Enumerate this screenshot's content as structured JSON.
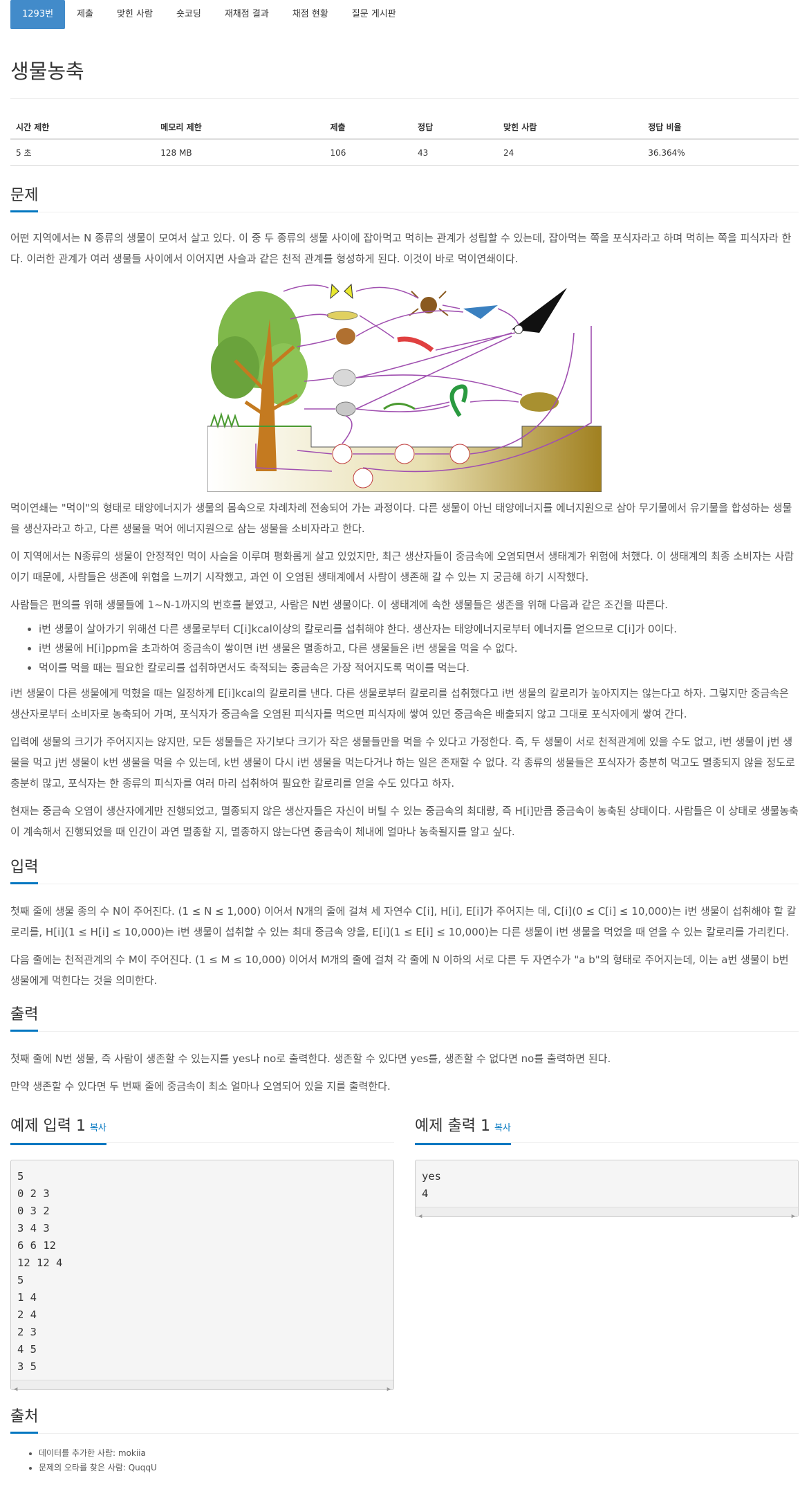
{
  "tabs": [
    {
      "label": "1293번",
      "active": true
    },
    {
      "label": "제출"
    },
    {
      "label": "맞힌 사람"
    },
    {
      "label": "숏코딩"
    },
    {
      "label": "재채점 결과"
    },
    {
      "label": "채점 현황"
    },
    {
      "label": "질문 게시판"
    }
  ],
  "problem_title": "생물농축",
  "info_table": {
    "headers": [
      "시간 제한",
      "메모리 제한",
      "제출",
      "정답",
      "맞힌 사람",
      "정답 비율"
    ],
    "values": [
      "5 초",
      "128 MB",
      "106",
      "43",
      "24",
      "36.364%"
    ]
  },
  "sections": {
    "problem": "문제",
    "input": "입력",
    "output": "출력",
    "source": "출처"
  },
  "problem_paragraphs": {
    "p1": "어떤 지역에서는 N 종류의 생물이 모여서 살고 있다. 이 중 두 종류의 생물 사이에 잡아먹고 먹히는 관계가 성립할 수 있는데, 잡아먹는 쪽을 포식자라고 하며 먹히는 쪽을 피식자라 한다. 이러한 관계가 여러 생물들 사이에서 이어지면 사슬과 같은 천적 관계를 형성하게 된다. 이것이 바로 먹이연쇄이다.",
    "p2": "먹이연쇄는 \"먹이\"의 형태로 태양에너지가 생물의 몸속으로 차례차례 전송되어 가는 과정이다. 다른 생물이 아닌 태양에너지를 에너지원으로 삼아 무기물에서 유기물을 합성하는 생물을 생산자라고 하고, 다른 생물을 먹어 에너지원으로 삼는 생물을 소비자라고 한다.",
    "p3": "이 지역에서는 N종류의 생물이 안정적인 먹이 사슬을 이루며 평화롭게 살고 있었지만, 최근 생산자들이 중금속에 오염되면서 생태계가 위험에 처했다. 이 생태계의 최종 소비자는 사람이기 때문에, 사람들은 생존에 위협을 느끼기 시작했고, 과연 이 오염된 생태계에서 사람이 생존해 갈 수 있는 지 궁금해 하기 시작했다.",
    "p4": "사람들은 편의를 위해 생물들에 1~N-1까지의 번호를 붙였고, 사람은 N번 생물이다. 이 생태계에 속한 생물들은 생존을 위해 다음과 같은 조건을 따른다.",
    "bullets": [
      "i번 생물이 살아가기 위해선 다른 생물로부터 C[i]kcal이상의 칼로리를 섭취해야 한다. 생산자는 태양에너지로부터 에너지를 얻으므로 C[i]가 0이다.",
      "i번 생물에 H[i]ppm을 초과하여 중금속이 쌓이면 i번 생물은 멸종하고, 다른 생물들은 i번 생물을 먹을 수 없다.",
      "먹이를 먹을 때는 필요한 칼로리를 섭취하면서도 축적되는 중금속은 가장 적어지도록 먹이를 먹는다."
    ],
    "p5": "i번 생물이 다른 생물에게 먹혔을 때는 일정하게 E[i]kcal의 칼로리를 낸다. 다른 생물로부터 칼로리를 섭취했다고 i번 생물의 칼로리가 높아지지는 않는다고 하자. 그렇지만 중금속은 생산자로부터 소비자로 농축되어 가며, 포식자가 중금속을 오염된 피식자를 먹으면 피식자에 쌓여 있던 중금속은 배출되지 않고 그대로 포식자에게 쌓여 간다.",
    "p6": "입력에 생물의 크기가 주어지지는 않지만, 모든 생물들은 자기보다 크기가 작은 생물들만을 먹을 수 있다고 가정한다. 즉, 두 생물이 서로 천적관계에 있을 수도 없고, i번 생물이 j번 생물을 먹고 j번 생물이 k번 생물을 먹을 수 있는데, k번 생물이 다시 i번 생물을 먹는다거나 하는 일은 존재할 수 없다. 각 종류의 생물들은 포식자가 충분히 먹고도 멸종되지 않을 정도로 충분히 많고, 포식자는 한 종류의 피식자를 여러 마리 섭취하여 필요한 칼로리를 얻을 수도 있다고 하자.",
    "p7": "현재는 중금속 오염이 생산자에게만 진행되었고, 멸종되지 않은 생산자들은 자신이 버틸 수 있는 중금속의 최대량, 즉 H[i]만큼 중금속이 농축된 상태이다. 사람들은 이 상태로 생물농축이 계속해서 진행되었을 때 인간이 과연 멸종할 지, 멸종하지 않는다면 중금속이 체내에 얼마나 농축될지를 알고 싶다."
  },
  "input_paragraphs": [
    "첫째 줄에 생물 종의 수 N이 주어진다. (1 ≤ N ≤ 1,000) 이어서 N개의 줄에 걸쳐 세 자연수 C[i], H[i], E[i]가 주어지는 데, C[i](0 ≤ C[i] ≤ 10,000)는 i번 생물이 섭취해야 할 칼로리를, H[i](1 ≤ H[i] ≤ 10,000)는 i번 생물이 섭취할 수 있는 최대 중금속 양을, E[i](1 ≤ E[i] ≤ 10,000)는 다른 생물이 i번 생물을 먹었을 때 얻을 수 있는 칼로리를 가리킨다.",
    "다음 줄에는 천적관계의 수 M이 주어진다. (1 ≤ M ≤ 10,000) 이어서 M개의 줄에 걸쳐 각 줄에 N 이하의 서로 다른 두 자연수가 \"a b\"의 형태로 주어지는데, 이는 a번 생물이 b번 생물에게 먹힌다는 것을 의미한다."
  ],
  "output_paragraphs": [
    "첫째 줄에 N번 생물, 즉 사람이 생존할 수 있는지를 yes나 no로 출력한다. 생존할 수 있다면 yes를, 생존할 수 없다면 no를 출력하면 된다.",
    "만약 생존할 수 있다면 두 번째 줄에 중금속이 최소 얼마나 오염되어 있을 지를 출력한다."
  ],
  "sample_input": {
    "title": "예제 입력 1",
    "copy": "복사",
    "content": "5\n0 2 3\n0 3 2\n3 4 3\n6 6 12\n12 12 4\n5\n1 4\n2 4\n2 3\n4 5\n3 5"
  },
  "sample_output": {
    "title": "예제 출력 1",
    "copy": "복사",
    "content": "yes\n4"
  },
  "source_items": [
    "데이터를 추가한 사람: mokiia",
    "문제의 오타를 찾은 사람: QuqqU"
  ],
  "colors": {
    "active_tab": "#428bca",
    "section_accent": "#0076c0",
    "arrow": "#a050b0"
  }
}
